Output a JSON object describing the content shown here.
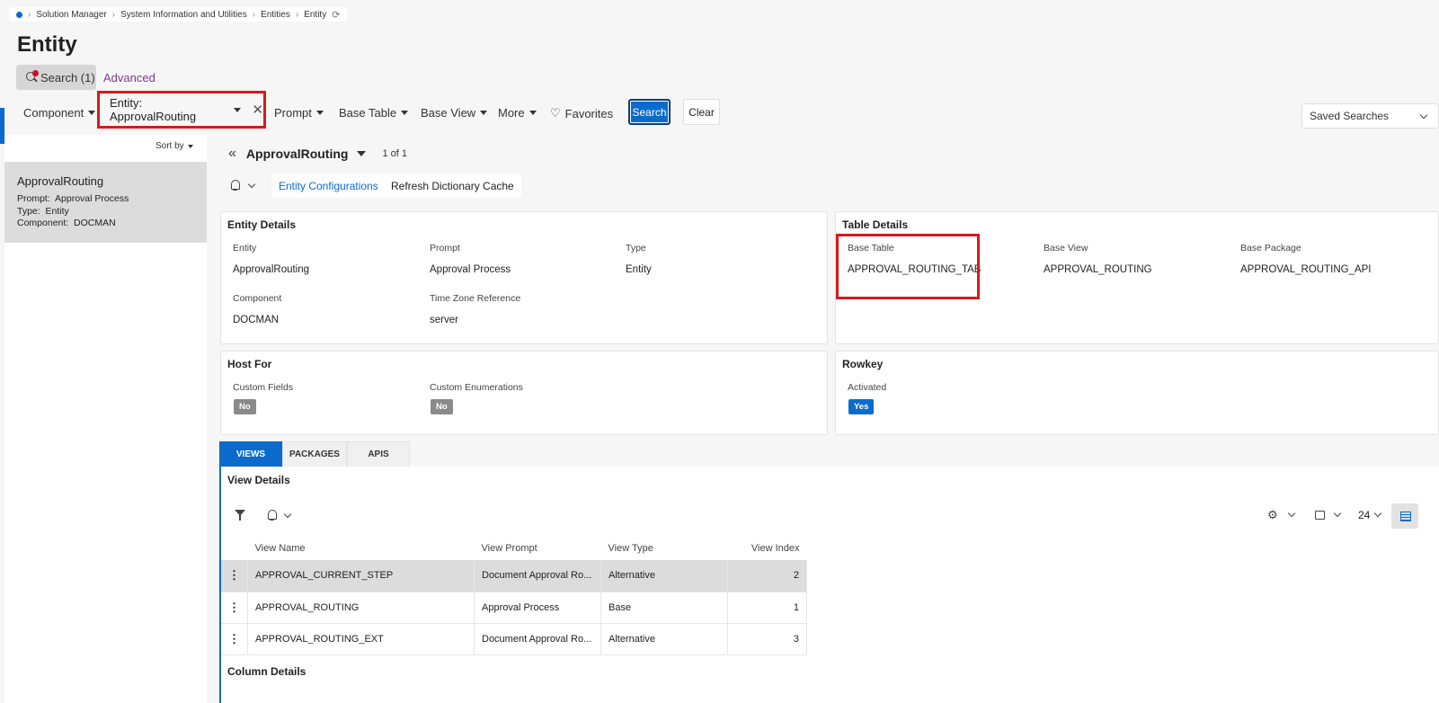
{
  "breadcrumb": {
    "items": [
      "Solution Manager",
      "System Information and Utilities",
      "Entities",
      "Entity"
    ]
  },
  "page": {
    "title": "Entity"
  },
  "search_tabs": {
    "search_label": "Search (1)",
    "advanced_label": "Advanced"
  },
  "filters": {
    "component": "Component",
    "entity_chip": "Entity: ApprovalRouting",
    "prompt": "Prompt",
    "base_table": "Base Table",
    "base_view": "Base View",
    "more": "More",
    "favorites": "Favorites",
    "search_button": "Search",
    "clear_button": "Clear",
    "saved_searches": "Saved Searches"
  },
  "list": {
    "sort_by": "Sort by",
    "items": [
      {
        "title": "ApprovalRouting",
        "prompt_label": "Prompt:",
        "prompt": "Approval Process",
        "type_label": "Type:",
        "type": "Entity",
        "component_label": "Component:",
        "component": "DOCMAN"
      }
    ]
  },
  "detail": {
    "title": "ApprovalRouting",
    "count": "1 of 1",
    "entity_configurations": "Entity Configurations",
    "refresh_cache": "Refresh Dictionary Cache"
  },
  "entity_details": {
    "title": "Entity Details",
    "entity_label": "Entity",
    "entity": "ApprovalRouting",
    "prompt_label": "Prompt",
    "prompt": "Approval Process",
    "type_label": "Type",
    "type": "Entity",
    "component_label": "Component",
    "component": "DOCMAN",
    "tz_label": "Time Zone Reference",
    "tz": "server"
  },
  "table_details": {
    "title": "Table Details",
    "base_table_label": "Base Table",
    "base_table": "APPROVAL_ROUTING_TAB",
    "base_view_label": "Base View",
    "base_view": "APPROVAL_ROUTING",
    "base_package_label": "Base Package",
    "base_package": "APPROVAL_ROUTING_API"
  },
  "host_for": {
    "title": "Host For",
    "custom_fields_label": "Custom Fields",
    "custom_fields": "No",
    "custom_enum_label": "Custom Enumerations",
    "custom_enum": "No"
  },
  "rowkey": {
    "title": "Rowkey",
    "activated_label": "Activated",
    "activated": "Yes"
  },
  "tabs": [
    "VIEWS",
    "PACKAGES",
    "APIS"
  ],
  "view_details": {
    "title": "View Details",
    "page_size": "24",
    "columns": [
      "View Name",
      "View Prompt",
      "View Type",
      "View Index"
    ],
    "rows": [
      [
        "APPROVAL_CURRENT_STEP",
        "Document Approval Ro...",
        "Alternative",
        "2"
      ],
      [
        "APPROVAL_ROUTING",
        "Approval Process",
        "Base",
        "1"
      ],
      [
        "APPROVAL_ROUTING_EXT",
        "Document Approval Ro...",
        "Alternative",
        "3"
      ]
    ]
  },
  "column_details": {
    "title": "Column Details"
  },
  "colors": {
    "accent": "#0b6bcb",
    "highlight": "#d7191f",
    "no_badge": "#8a8a8a"
  }
}
